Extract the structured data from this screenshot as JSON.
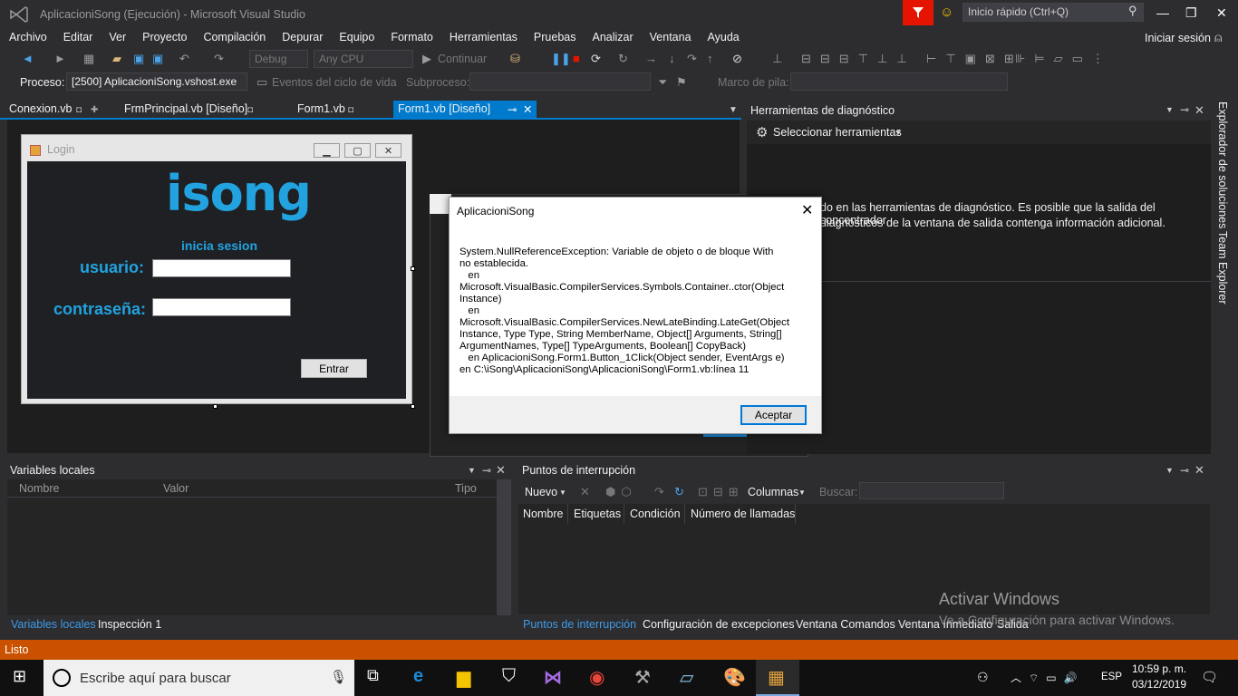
{
  "window": {
    "title": "AplicacioniSong (Ejecución) - Microsoft Visual Studio"
  },
  "quick_launch": {
    "placeholder": "Inicio rápido (Ctrl+Q)"
  },
  "menu": [
    "Archivo",
    "Editar",
    "Ver",
    "Proyecto",
    "Compilación",
    "Depurar",
    "Equipo",
    "Formato",
    "Herramientas",
    "Pruebas",
    "Analizar",
    "Ventana",
    "Ayuda"
  ],
  "signin": "Iniciar sesión",
  "toolbar": {
    "config": "Debug",
    "platform": "Any CPU",
    "continue": "Continuar",
    "process_label": "Proceso:",
    "process_value": "[2500] AplicacioniSong.vshost.exe",
    "lifecycle": "Eventos del ciclo de vida",
    "thread_label": "Subproceso:",
    "stack_label": "Marco de pila:"
  },
  "tabs": [
    "Conexion.vb",
    "FrmPrincipal.vb [Diseño]",
    "Form1.vb",
    "Form1.vb [Diseño]"
  ],
  "form": {
    "title": "Login",
    "logo": "isong",
    "subtitle": "inicia sesion",
    "user_label": "usuario:",
    "pass_label": "contraseña:",
    "button": "Entrar"
  },
  "diagnostics": {
    "title": "Herramientas de diagnóstico",
    "select_tools": "Seleccionar herramientas",
    "message_line1": "do en las herramientas de diagnóstico. Es posible que la salida del concentrador",
    "message_line2": "diagnósticos de la ventana de salida contenga información adicional."
  },
  "side_tabs": [
    "Explorador de soluciones",
    "Team Explorer"
  ],
  "dialog": {
    "title": "AplicacioniSong",
    "message": "System.NullReferenceException: Variable de objeto o de bloque With\nno establecida.\n   en\nMicrosoft.VisualBasic.CompilerServices.Symbols.Container..ctor(Object\nInstance)\n   en\nMicrosoft.VisualBasic.CompilerServices.NewLateBinding.LateGet(Object\nInstance, Type Type, String MemberName, Object[] Arguments, String[]\nArgumentNames, Type[] TypeArguments, Boolean[] CopyBack)\n   en AplicacioniSong.Form1.Button_1Click(Object sender, EventArgs e)\nen C:\\iSong\\AplicacioniSong\\AplicacioniSong\\Form1.vb:línea 11",
    "ok": "Aceptar"
  },
  "locals": {
    "title": "Variables locales",
    "cols": [
      "Nombre",
      "Valor",
      "Tipo"
    ],
    "tabs": [
      "Variables locales",
      "Inspección 1"
    ]
  },
  "breakpoints": {
    "title": "Puntos de interrupción",
    "new": "Nuevo",
    "columns": "Columnas",
    "search": "Buscar:",
    "cols": [
      "Nombre",
      "Etiquetas",
      "Condición",
      "Número de llamadas"
    ],
    "tabs": [
      "Puntos de interrupción",
      "Configuración de excepciones",
      "Ventana Comandos",
      "Ventana Inmediato",
      "Salida"
    ]
  },
  "watermark": {
    "line1": "Activar Windows",
    "line2": "Ve a Configuración para activar Windows."
  },
  "status": "Listo",
  "taskbar": {
    "search_placeholder": "Escribe aquí para buscar",
    "lang": "ESP",
    "time": "10:59 p. m.",
    "date": "03/12/2019"
  },
  "colors": {
    "accent": "#007acc",
    "status": "#ca5100",
    "logo": "#22a3e0"
  }
}
